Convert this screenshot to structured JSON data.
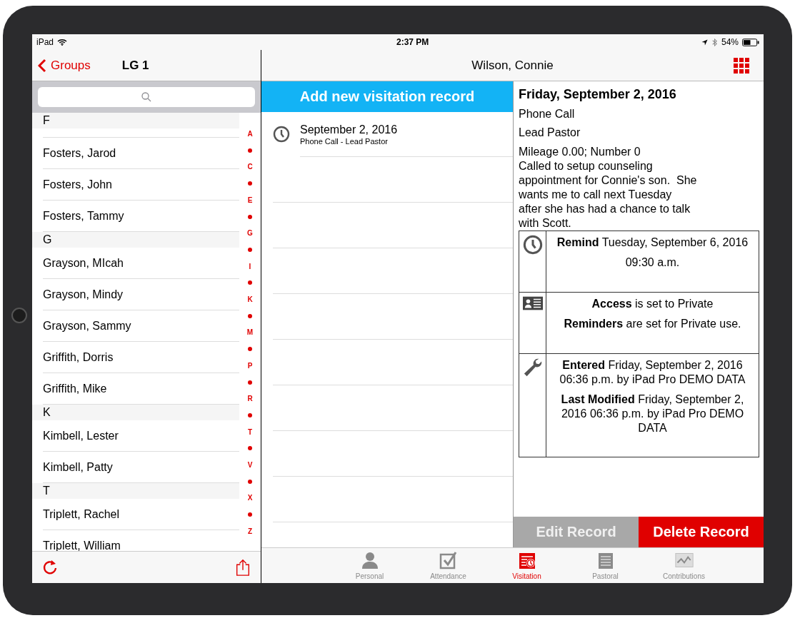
{
  "status_bar": {
    "device": "iPad",
    "time": "2:37 PM",
    "battery": "54%"
  },
  "left_nav": {
    "back": "Groups",
    "title": "LG 1"
  },
  "nav_title": "Wilson, Connie",
  "sections": [
    {
      "letter": "F",
      "people": [
        "Fosters, Jarod",
        "Fosters, John",
        "Fosters, Tammy"
      ]
    },
    {
      "letter": "G",
      "people": [
        "Grayson, MIcah",
        "Grayson, Mindy",
        "Grayson, Sammy",
        "Griffith, Dorris",
        "Griffith, Mike"
      ]
    },
    {
      "letter": "K",
      "people": [
        "Kimbell, Lester",
        "Kimbell, Patty"
      ]
    },
    {
      "letter": "T",
      "people": [
        "Triplett, Rachel",
        "Triplett, William"
      ]
    }
  ],
  "index": [
    "A",
    "C",
    "E",
    "G",
    "I",
    "K",
    "M",
    "P",
    "R",
    "T",
    "V",
    "X",
    "Z"
  ],
  "add_button": "Add new visitation record",
  "visits": [
    {
      "date": "September 2, 2016",
      "detail": "Phone Call - Lead Pastor"
    }
  ],
  "record": {
    "title": "Friday, September 2, 2016",
    "type": "Phone Call",
    "by": "Lead Pastor",
    "notes": "Mileage 0.00; Number 0\nCalled to setup counseling\nappointment for Connie's son.  She\nwants me to call next Tuesday\nafter she has had a chance to talk\nwith Scott.",
    "info": [
      {
        "kind": "clock",
        "lines": [
          "**Remind** Tuesday, September 6, 2016",
          "09:30 a.m."
        ]
      },
      {
        "kind": "card",
        "lines": [
          "**Access** is set to Private",
          "**Reminders** are set for Private use."
        ]
      },
      {
        "kind": "wrench",
        "lines": [
          "**Entered** Friday, September 2, 2016 06:36 p.m. by iPad Pro DEMO DATA",
          "**Last Modified** Friday, September 2, 2016 06:36 p.m. by iPad Pro DEMO DATA"
        ]
      }
    ]
  },
  "actions": [
    {
      "label": "Edit Record",
      "disabled": true
    },
    {
      "label": "Delete Record",
      "disabled": false
    }
  ],
  "tabs": [
    {
      "label": "Personal",
      "kind": "person",
      "selected": false
    },
    {
      "label": "Attendance",
      "kind": "check",
      "selected": false
    },
    {
      "label": "Visitation",
      "kind": "visit",
      "selected": true
    },
    {
      "label": "Pastoral",
      "kind": "notes",
      "selected": false
    },
    {
      "label": "Contributions",
      "kind": "chart",
      "selected": false
    }
  ]
}
